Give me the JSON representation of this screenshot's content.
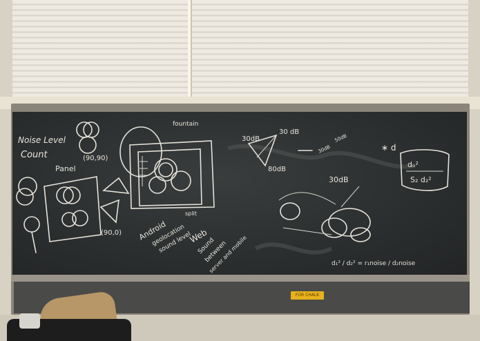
{
  "board_text": {
    "noise_level_count_1": "Noise Level",
    "noise_level_count_2": "Count",
    "panel": "Panel",
    "coord_top": "(90,90)",
    "coord_bottom": "(90,0)",
    "fountain": "fountain",
    "split": "split",
    "android_1": "Android",
    "android_2": "geolocation",
    "android_3": "sound level",
    "web_1": "Web",
    "web_2": "Sound",
    "web_3": "between",
    "web_4": "server and mobile",
    "db_30a": "30dB",
    "db_30b": "30 dB",
    "db_80": "80dB",
    "db_30c": "30dB",
    "db_50": "50dB",
    "db_30d": "30dB",
    "formula_num": "dₒ²",
    "formula_den": "S₂ d₂²",
    "ratio": "d₁² / d₂² = r₁noise / d₂noise"
  },
  "sticker": {
    "label": "FOR CHALK"
  }
}
